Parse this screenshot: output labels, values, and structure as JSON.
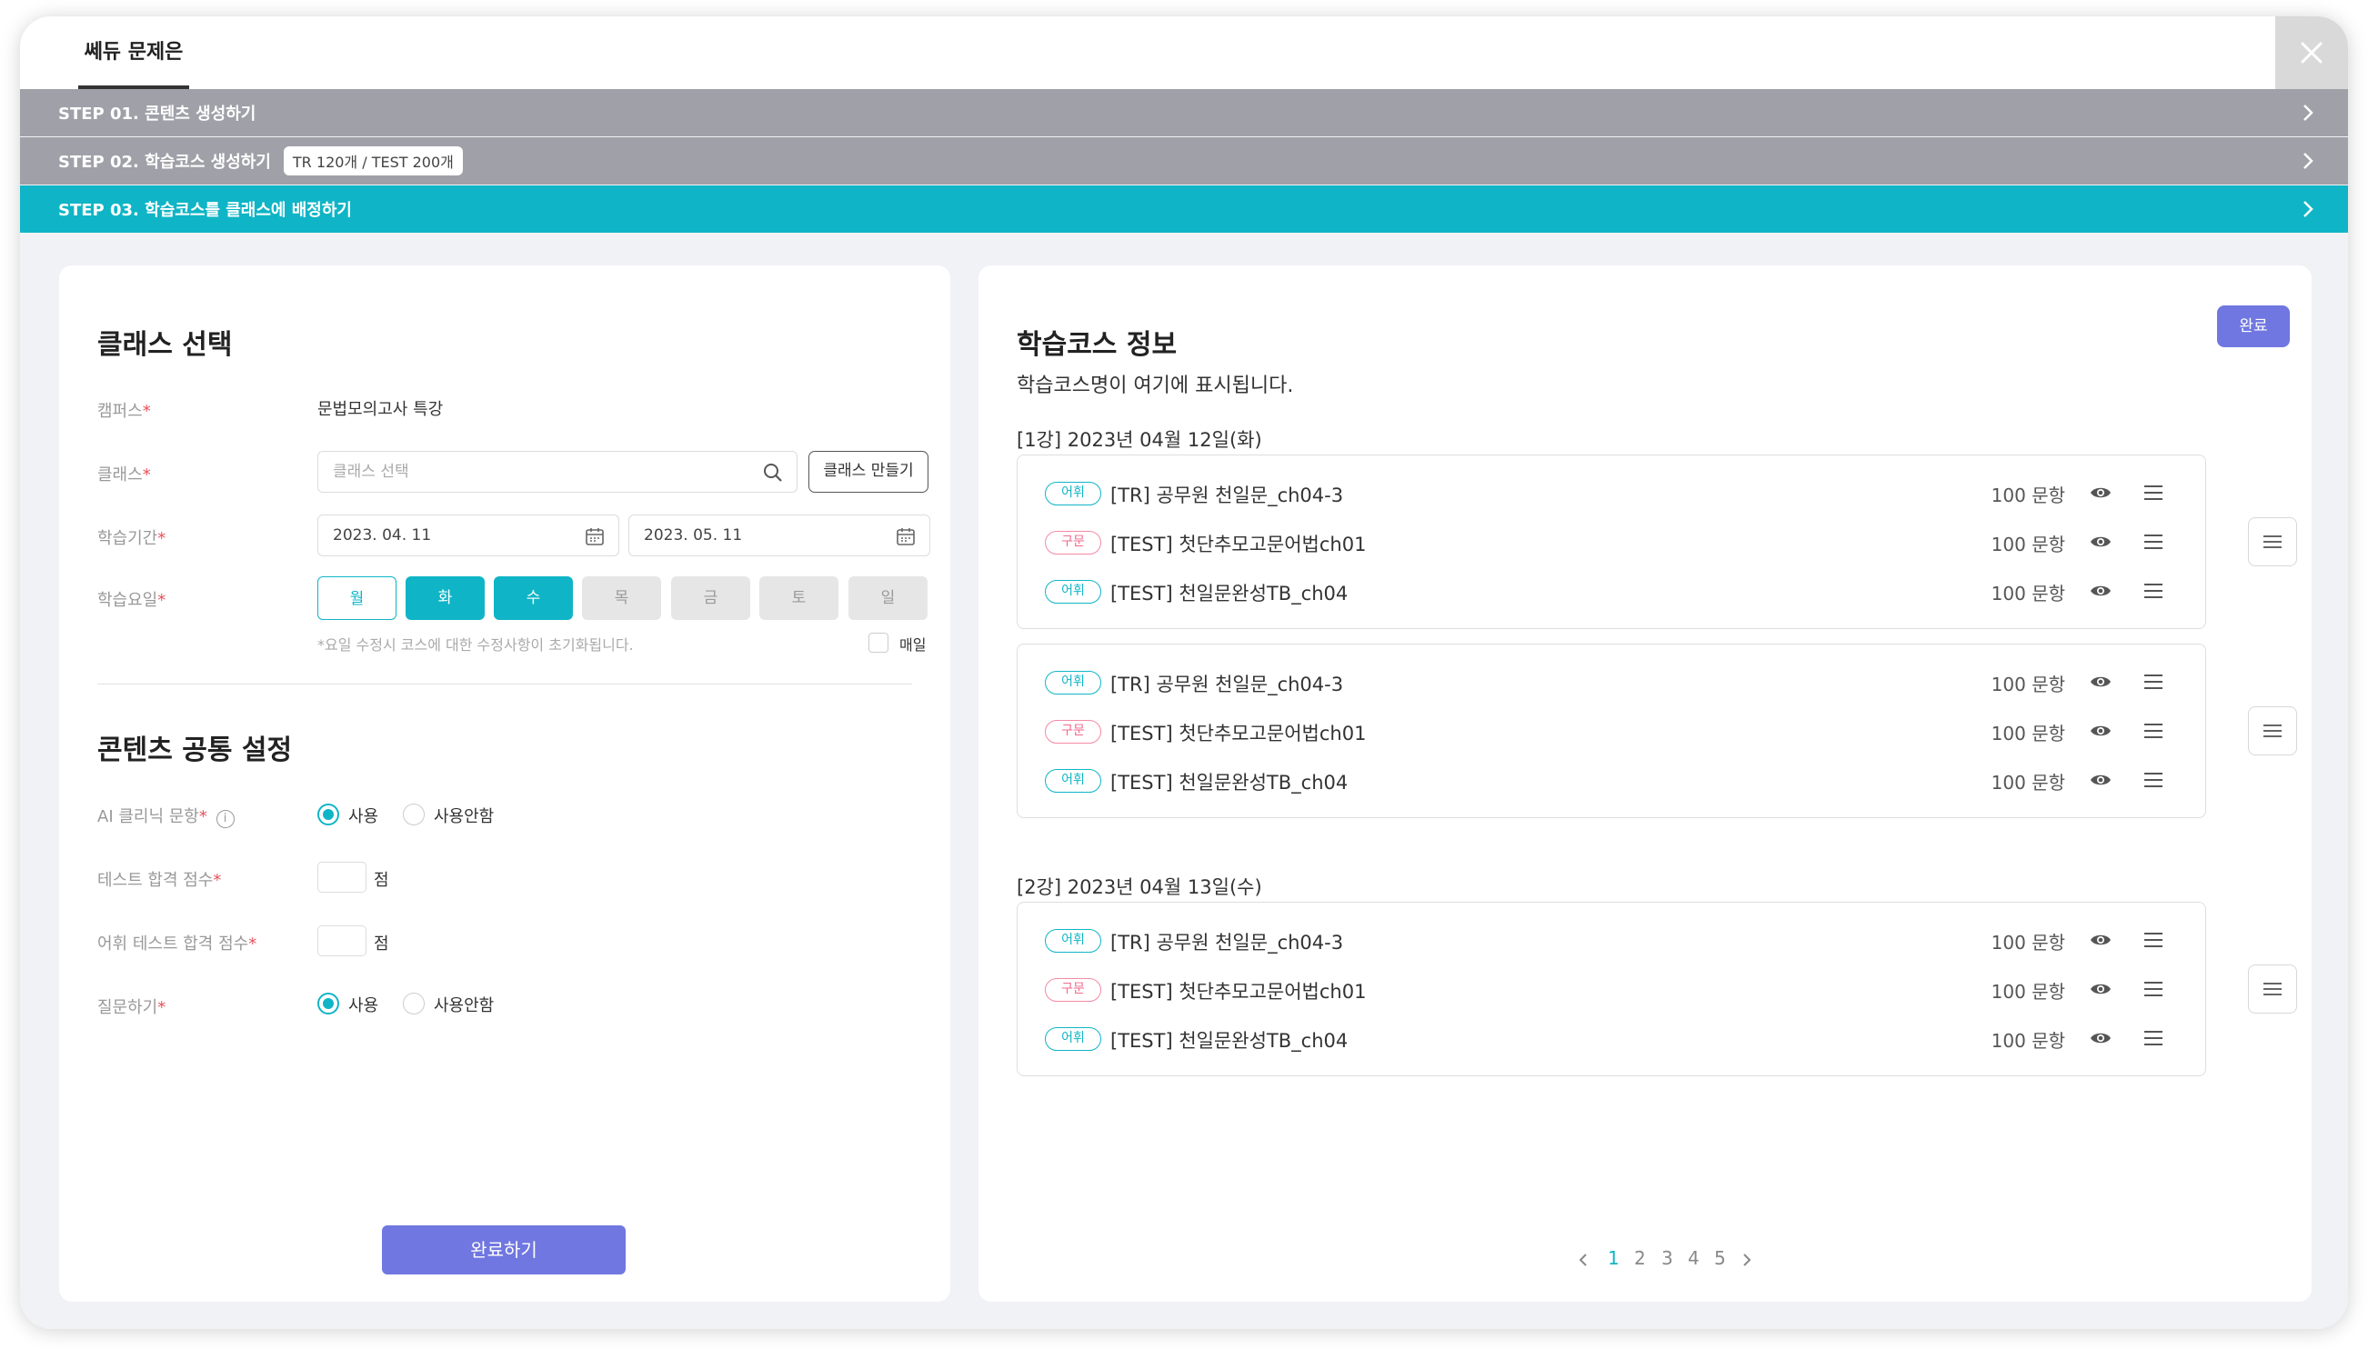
{
  "app": {
    "tab_label": "쎄듀 문제은행"
  },
  "steps": [
    {
      "label": "STEP 01. 콘텐츠 생성하기"
    },
    {
      "label": "STEP 02. 학습코스 생성하기",
      "badge": "TR 120개 / TEST 200개"
    },
    {
      "label": "STEP 03. 학습코스를 클래스에 배정하기"
    }
  ],
  "class_select": {
    "title": "클래스 선택",
    "campus_label": "캠퍼스",
    "campus_value": "문법모의고사 특강",
    "class_label": "클래스",
    "class_placeholder": "클래스 선택",
    "create_class_button": "클래스 만들기",
    "period_label": "학습기간",
    "period_start": "2023. 04. 11",
    "period_end": "2023. 05. 11",
    "days_label": "학습요일",
    "days": [
      "월",
      "화",
      "수",
      "목",
      "금",
      "토",
      "일"
    ],
    "days_note": "*요일 수정시 코스에 대한 수정사항이 초기화됩니다.",
    "everyday_label": "매일",
    "required_mark": "*"
  },
  "common_settings": {
    "title": "콘텐츠 공통 설정",
    "ai_clinic_label": "AI 클리닉 문항",
    "use_label": "사용",
    "no_use_label": "사용안함",
    "test_pass_label": "테스트 합격 점수",
    "vocab_test_pass_label": "어휘 테스트 합격 점수",
    "point_unit": "점",
    "question_label": "질문하기",
    "info_icon": "i"
  },
  "submit_button": "완료하기",
  "course_info": {
    "title": "학습코스 정보",
    "done_button": "완료",
    "course_name": "학습코스명이 여기에 표시됩니다.",
    "lessons": [
      {
        "title": "[1강] 2023년 04월 12일(화)",
        "groups": [
          [
            {
              "tag": "어휘",
              "title": "[TR] 공무원 천일문_ch04-3",
              "count": "100 문항"
            },
            {
              "tag": "구문",
              "title": "[TEST] 첫단추모고문어법ch01",
              "count": "100 문항"
            },
            {
              "tag": "어휘",
              "title": "[TEST] 천일문완성TB_ch04",
              "count": "100 문항"
            }
          ],
          [
            {
              "tag": "어휘",
              "title": "[TR] 공무원 천일문_ch04-3",
              "count": "100 문항"
            },
            {
              "tag": "구문",
              "title": "[TEST] 첫단추모고문어법ch01",
              "count": "100 문항"
            },
            {
              "tag": "어휘",
              "title": "[TEST] 천일문완성TB_ch04",
              "count": "100 문항"
            }
          ]
        ]
      },
      {
        "title": "[2강] 2023년 04월 13일(수)",
        "groups": [
          [
            {
              "tag": "어휘",
              "title": "[TR] 공무원 천일문_ch04-3",
              "count": "100 문항"
            },
            {
              "tag": "구문",
              "title": "[TEST] 첫단추모고문어법ch01",
              "count": "100 문항"
            },
            {
              "tag": "어휘",
              "title": "[TEST] 천일문완성TB_ch04",
              "count": "100 문항"
            }
          ]
        ]
      }
    ]
  },
  "pagination": {
    "pages": [
      "1",
      "2",
      "3",
      "4",
      "5"
    ],
    "current": "1"
  },
  "colors": {
    "accent": "#0fb5c6",
    "primary": "#7077e0",
    "step_gray": "#a0a0a8",
    "tag_pink": "#f06a8c"
  },
  "icons": [
    "close-icon",
    "chevron-right-icon",
    "search-icon",
    "calendar-icon",
    "eye-icon",
    "menu-icon",
    "info-icon"
  ]
}
